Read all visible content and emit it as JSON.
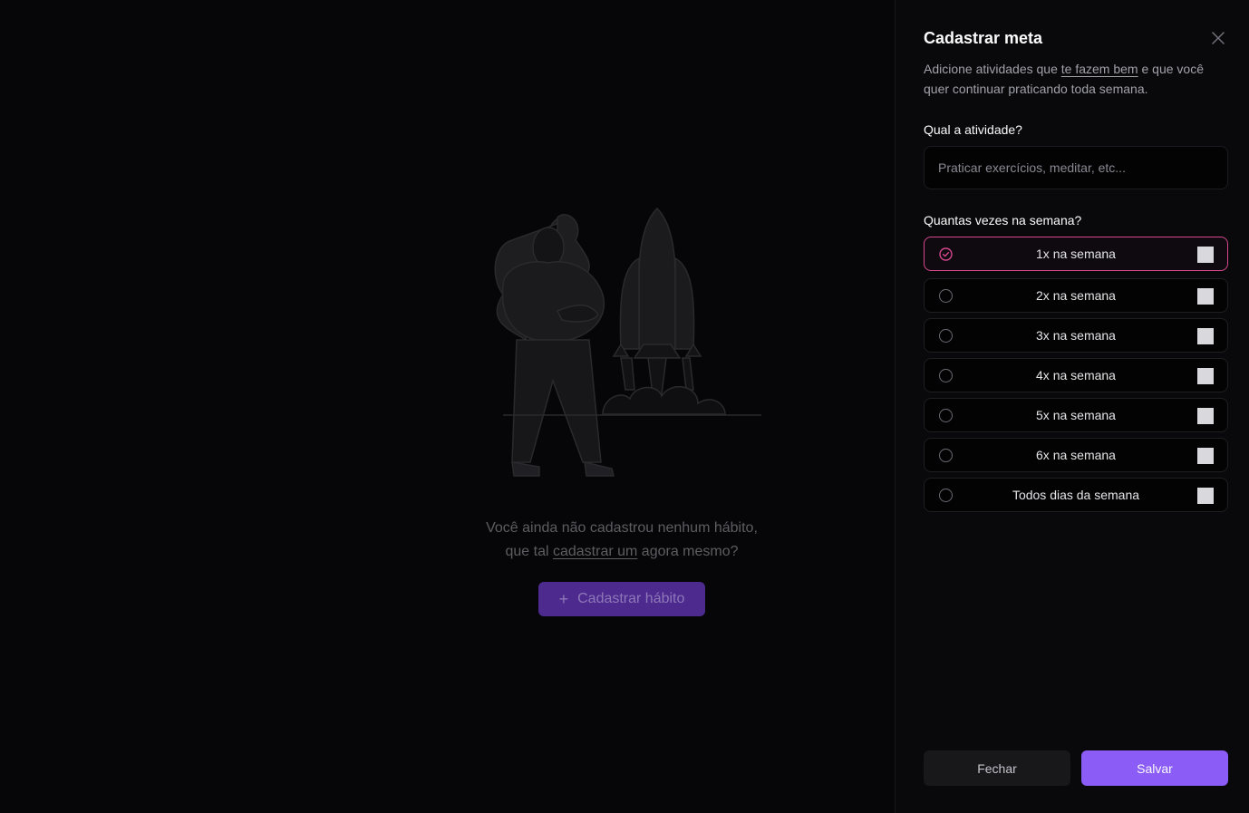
{
  "empty_state": {
    "line1": "Você ainda não cadastrou nenhum hábito,",
    "line2_pre": "que tal ",
    "line2_link": "cadastrar um",
    "line2_post": " agora mesmo?",
    "cta_label": "Cadastrar hábito",
    "cta_icon": "plus-icon"
  },
  "panel": {
    "title": "Cadastrar meta",
    "close_icon": "close-icon",
    "description_pre": "Adicione atividades que ",
    "description_link": "te fazem bem",
    "description_post": " e que você quer continuar praticando toda semana.",
    "activity_label": "Qual a atividade?",
    "activity_placeholder": "Praticar exercícios, meditar, etc...",
    "activity_value": "",
    "frequency_label": "Quantas vezes na semana?",
    "frequency_options": [
      {
        "label": "1x na semana",
        "selected": true
      },
      {
        "label": "2x na semana",
        "selected": false
      },
      {
        "label": "3x na semana",
        "selected": false
      },
      {
        "label": "4x na semana",
        "selected": false
      },
      {
        "label": "5x na semana",
        "selected": false
      },
      {
        "label": "6x na semana",
        "selected": false
      },
      {
        "label": "Todos dias da semana",
        "selected": false
      }
    ],
    "close_button": "Fechar",
    "save_button": "Salvar"
  },
  "colors": {
    "accent": "#8b5cf6",
    "selected_border": "#d6478d",
    "background": "#09090b"
  }
}
